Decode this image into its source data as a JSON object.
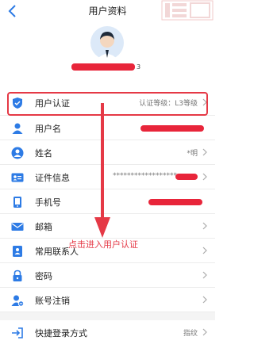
{
  "header": {
    "title": "用户资料"
  },
  "profile": {
    "name_suffix": "3"
  },
  "rows": [
    {
      "label": "用户认证",
      "value": "认证等级：L3等级"
    },
    {
      "label": "用户名",
      "value": ""
    },
    {
      "label": "姓名",
      "value": "*明"
    },
    {
      "label": "证件信息",
      "value": "******************"
    },
    {
      "label": "手机号",
      "value": ""
    },
    {
      "label": "邮箱",
      "value": ""
    },
    {
      "label": "常用联系人",
      "value": ""
    },
    {
      "label": "密码",
      "value": ""
    },
    {
      "label": "账号注销",
      "value": ""
    }
  ],
  "quick_login": {
    "label": "快捷登录方式",
    "value": "指纹"
  },
  "annotation": {
    "text": "点击进入用户认证"
  },
  "colors": {
    "accent": "#2d7be5",
    "highlight": "#e53946",
    "redaction": "#e8253a"
  }
}
